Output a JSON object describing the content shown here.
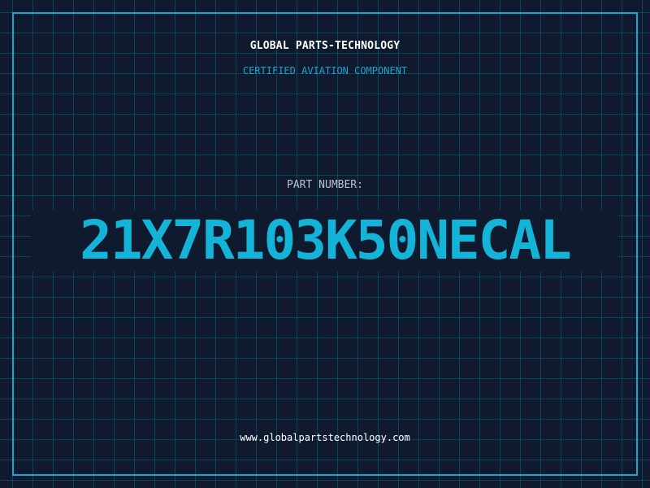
{
  "header": {
    "company": "GLOBAL PARTS-TECHNOLOGY",
    "tagline": "CERTIFIED AVIATION COMPONENT"
  },
  "part": {
    "label": "PART NUMBER:",
    "number": "21X7R103K50NECAL"
  },
  "footer": {
    "website": "www.globalpartstechnology.com"
  },
  "colors": {
    "background": "#101a2e",
    "accent": "#1aa4cf",
    "part_number": "#14b4d8",
    "text": "#ffffff",
    "label": "#b8c3d0"
  }
}
